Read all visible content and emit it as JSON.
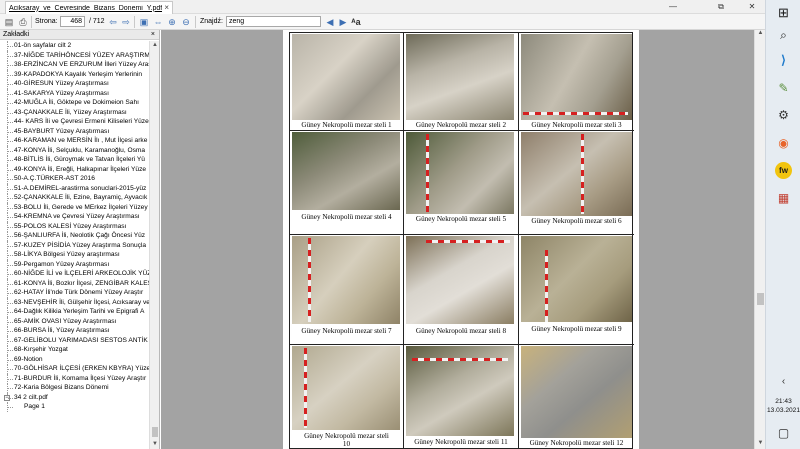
{
  "window": {
    "tab_title": "Aciksaray_ve_Cevresinde_Bizans_Donemi_Y.pdf",
    "tab_close": "×",
    "minimize": "—",
    "restore": "⧉",
    "close": "✕"
  },
  "toolbar": {
    "page_label": "Strona:",
    "page_value": "468",
    "page_total": "/ 712",
    "find_label": "Znajdź:",
    "find_value": "zeng"
  },
  "sidebar": {
    "header": "Zakładki",
    "close": "×",
    "items": [
      {
        "label": "01-ön sayfalar cilt 2",
        "type": "item"
      },
      {
        "label": "37-NİĞDE TARİHÖNCESİ YÜZEY ARAŞTIRMA",
        "type": "item"
      },
      {
        "label": "38-ERZİNCAN VE ERZURUM İlleri Yüzey Araş",
        "type": "item"
      },
      {
        "label": "39-KAPADOKYA Kayalık Yerleşim Yerlerinin",
        "type": "item"
      },
      {
        "label": "40-GİRESUN Yüzey Araştırması",
        "type": "item"
      },
      {
        "label": "41-SAKARYA Yüzey Araştırması",
        "type": "item"
      },
      {
        "label": "42-MUĞLA İli, Göktepe ve Dokimeion Sahı",
        "type": "item"
      },
      {
        "label": "43-ÇANAKKALE İli, Yüzey Araştırması",
        "type": "item"
      },
      {
        "label": "44- KARS İli ve Çevresi Ermeni Kiliseleri Yüze",
        "type": "item"
      },
      {
        "label": "45-BAYBURT Yüzey Araştırması",
        "type": "item"
      },
      {
        "label": "46-KARAMAN ve MERSİN İlı , Mut İlçesi arke",
        "type": "item"
      },
      {
        "label": "47-KONYA İli, Selçuklu, Karamanoğlu, Osma",
        "type": "item"
      },
      {
        "label": "48-BİTLİS İli, Güroymak ve Tatvan İlçeleri Yü",
        "type": "item"
      },
      {
        "label": "49-KONYA İli, Ereğli, Halkapınar İlçeleri Yüze",
        "type": "item"
      },
      {
        "label": "50-A.Ç.TÜRKER-AST 2016",
        "type": "item"
      },
      {
        "label": "51-A.DEMİREL-arastirma sonuclari-2015-yüz",
        "type": "item"
      },
      {
        "label": "52-ÇANAKKALE İli, Ezine, Bayramiç, Ayvacık",
        "type": "item"
      },
      {
        "label": "53-BOLU İli, Gerede ve MErkez İlçeleri Yüzey",
        "type": "item"
      },
      {
        "label": "54-KREMNA ve Çevresi Yüzey Araştırması",
        "type": "item"
      },
      {
        "label": "55-POLOS KALESİ Yüzey Araştırması",
        "type": "item"
      },
      {
        "label": "56-ŞANLIURFA İli, Neolotik Çağı Öncesi Yüz",
        "type": "item"
      },
      {
        "label": "57-KUZEY PİSİDİA Yüzey Araştırma Sonuçla",
        "type": "item"
      },
      {
        "label": "58-LİKYA Bölgesi Yüzey araştırması",
        "type": "item"
      },
      {
        "label": "59-Pergamon Yüzey Araştırması",
        "type": "item"
      },
      {
        "label": "60-NİĞDE İLİ ve İLÇELERİ ARKEOLOJİK YÜZE",
        "type": "item"
      },
      {
        "label": "61-KONYA İli, Bozkır İlçesi, ZENGİBAR KALES",
        "type": "item"
      },
      {
        "label": "62-HATAY İli'nde Türk Dönemi Yüzey Araştır",
        "type": "item"
      },
      {
        "label": "63-NEVŞEHİR İli, Gülşehir İlçesi, Acıksaray ve",
        "type": "item"
      },
      {
        "label": "64-Dağlık Kilikia Yerleşim Tarihi ve Epigrafi A",
        "type": "item"
      },
      {
        "label": "65-AMİK OVASI Yüzey Araştırması",
        "type": "item"
      },
      {
        "label": "66-BURSA İli, Yüzey Araştırması",
        "type": "item"
      },
      {
        "label": "67-GELİBOLU YARIMADASI SESTOS ANTİK K",
        "type": "item"
      },
      {
        "label": "68-Kırşehir Yozgat",
        "type": "item"
      },
      {
        "label": "69-Notion",
        "type": "item"
      },
      {
        "label": "70-GÖLHİSAR İLÇESİ (ERKEN KBYRA) Yüzey",
        "type": "item"
      },
      {
        "label": "71-BURDUR İli, Komama İlçesi Yüzey Araştır",
        "type": "item"
      },
      {
        "label": "72-Karia Bölgesi Bizans Dönemi",
        "type": "item"
      },
      {
        "label": "34 2 cilt.pdf",
        "type": "expander"
      },
      {
        "label": "Page 1",
        "type": "sub"
      }
    ]
  },
  "document": {
    "captions": [
      "Güney Nekropolü mezar steli 1",
      "Güney Nekropolü mezar steli 2",
      "Güney Nekropolü mezar steli 3",
      "Güney Nekropolü mezar steli 4",
      "Güney Nekropolü mezar steli 5",
      "Güney Nekropolü mezar steli 6",
      "Güney Nekropolü mezar steli 7",
      "Güney Nekropolü mezar steli 8",
      "Güney Nekropolü mezar steli 9",
      "Güney Nekropolü mezar steli",
      "10",
      "Güney Nekropolü mezar steli 11",
      "Güney Nekropolü mezar steli 12"
    ]
  },
  "taskbar": {
    "time": "21:43",
    "date": "13.03.2021"
  }
}
